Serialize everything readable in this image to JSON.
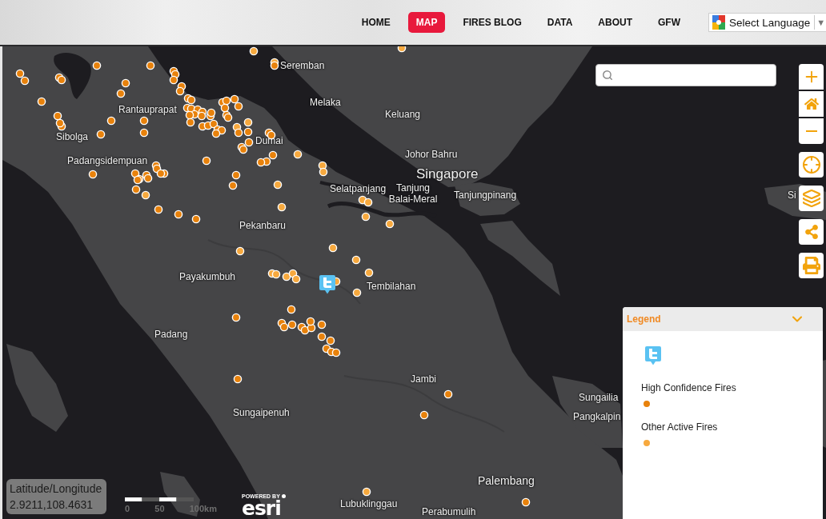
{
  "header": {
    "nav": [
      {
        "label": "HOME",
        "selected": false
      },
      {
        "label": "MAP",
        "selected": true
      },
      {
        "label": "FIRES BLOG",
        "selected": false
      },
      {
        "label": "DATA",
        "selected": false
      },
      {
        "label": "ABOUT",
        "selected": false
      },
      {
        "label": "GFW",
        "selected": false
      }
    ],
    "language_select": {
      "value": "Select Language",
      "arrow": "▼"
    }
  },
  "map": {
    "labels": [
      {
        "text": "Seremban",
        "kind": "town"
      },
      {
        "text": "Melaka",
        "kind": "town"
      },
      {
        "text": "Rantauprapat",
        "kind": "town"
      },
      {
        "text": "Keluang",
        "kind": "town"
      },
      {
        "text": "Sibolga",
        "kind": "town"
      },
      {
        "text": "Dumai",
        "kind": "town"
      },
      {
        "text": "Johor Bahru",
        "kind": "town"
      },
      {
        "text": "Padangsidempuan",
        "kind": "town"
      },
      {
        "text": "Singapore",
        "kind": "capital"
      },
      {
        "text": "Selatpanjang",
        "kind": "town"
      },
      {
        "text": "Tanjung Balai-Meral",
        "kind": "town"
      },
      {
        "text": "Tanjungpinang",
        "kind": "town"
      },
      {
        "text": "Si",
        "kind": "town"
      },
      {
        "text": "Pekanbaru",
        "kind": "town"
      },
      {
        "text": "Payakumbuh",
        "kind": "town"
      },
      {
        "text": "Tembilahan",
        "kind": "town"
      },
      {
        "text": "Padang",
        "kind": "town"
      },
      {
        "text": "Jambi",
        "kind": "town"
      },
      {
        "text": "Sungailia",
        "kind": "town"
      },
      {
        "text": "Sungaipenuh",
        "kind": "town"
      },
      {
        "text": "Pangkalpin",
        "kind": "town"
      },
      {
        "text": "Palembang",
        "kind": "city"
      },
      {
        "text": "Lubuklinggau",
        "kind": "town"
      },
      {
        "text": "Perabumulih",
        "kind": "town"
      }
    ]
  },
  "legend": {
    "title": "Legend",
    "expanded": true,
    "items": [
      {
        "label": "High Confidence Fires",
        "color": "#e8820c"
      },
      {
        "label": "Other Active Fires",
        "color": "#f7a93e"
      }
    ]
  },
  "coordinates": {
    "label": "Latitude/Longitude",
    "value": "2.9211,108.4631"
  },
  "scale_bar": {
    "labels": [
      "0",
      "50",
      "100km"
    ]
  },
  "attribution": {
    "caption": "POWERED BY",
    "wordmark": "esri"
  }
}
